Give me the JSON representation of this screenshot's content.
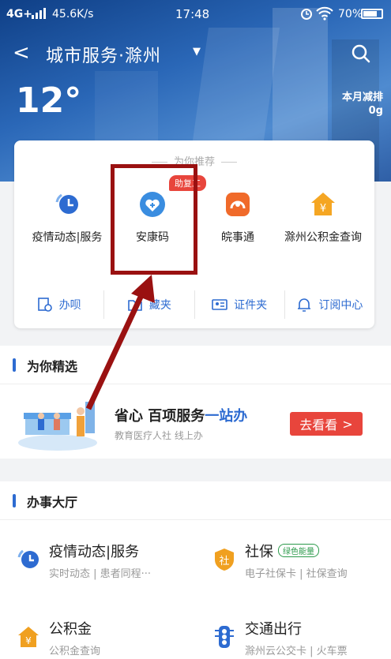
{
  "status": {
    "network": "4G+",
    "speed": "45.6K/s",
    "time": "17:48",
    "battery": "70%"
  },
  "nav": {
    "title": "城市服务·滁州"
  },
  "weather": {
    "temp": "12°",
    "emission_label": "本月减排",
    "emission_value": "0g"
  },
  "recommend": {
    "title": "为你推荐",
    "badge": "助复工",
    "services": [
      {
        "label": "疫情动态|服务",
        "icon": "epidemic-clock-icon"
      },
      {
        "label": "安康码",
        "icon": "heart-shield-icon"
      },
      {
        "label": "皖事通",
        "icon": "wanshitong-icon"
      },
      {
        "label": "滁州公积金查询",
        "icon": "housing-fund-icon"
      }
    ],
    "tools": [
      {
        "label": "办呗"
      },
      {
        "label": "藏夹"
      },
      {
        "label": "证件夹"
      },
      {
        "label": "订阅中心"
      }
    ]
  },
  "featured": {
    "title": "为你精选",
    "headline_a": "省心 百项服务",
    "headline_b": "一站办",
    "sub": "教育医疗人社 线上办",
    "cta": "去看看"
  },
  "hall": {
    "title": "办事大厅",
    "items": [
      {
        "name": "疫情动态|服务",
        "desc": "实时动态 | 患者同程···",
        "icon": "epidemic-clock-icon"
      },
      {
        "name": "社保",
        "tag": "绿色能量",
        "desc": "电子社保卡 | 社保查询",
        "icon": "social-security-icon"
      },
      {
        "name": "公积金",
        "desc": "公积金查询",
        "icon": "housing-fund-icon"
      },
      {
        "name": "交通出行",
        "desc": "滁州云公交卡 | 火车票",
        "icon": "traffic-light-icon"
      }
    ]
  },
  "colors": {
    "brand_blue": "#2d6bd1",
    "accent_red": "#e8453c",
    "annotation": "#9a1111"
  }
}
